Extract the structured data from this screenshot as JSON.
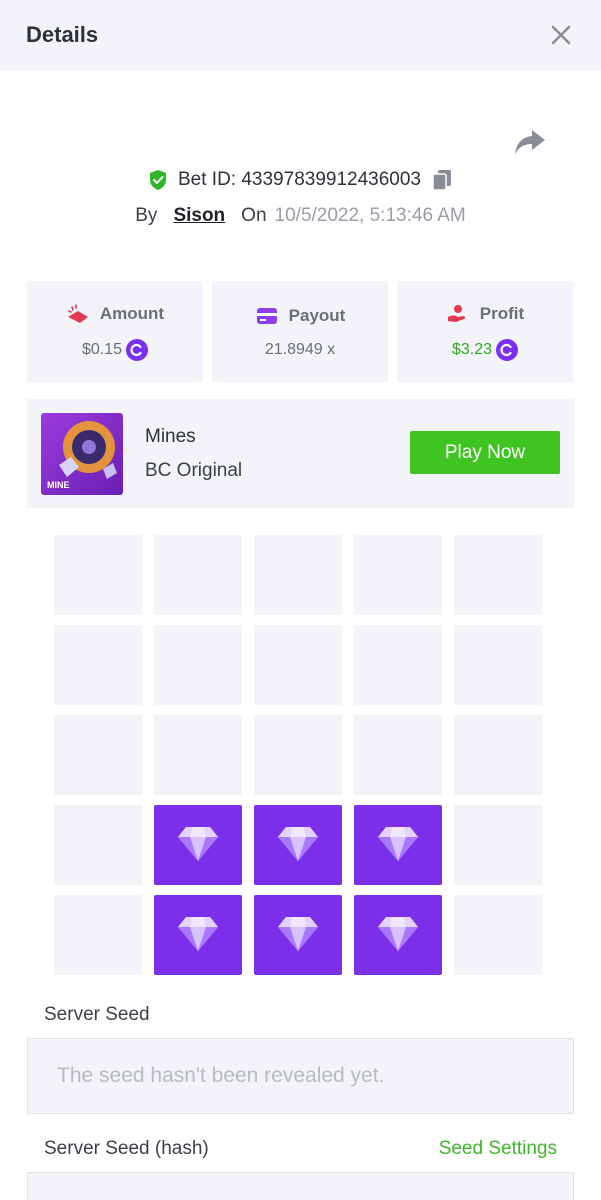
{
  "header": {
    "title": "Details",
    "close_icon": "close-icon"
  },
  "bet": {
    "id_label": "Bet ID: 43397839912436003",
    "by_label": "By",
    "user": "Sison",
    "on_label": "On",
    "date": "10/5/2022, 5:13:46 AM"
  },
  "stats": {
    "amount": {
      "label": "Amount",
      "value": "$0.15"
    },
    "payout": {
      "label": "Payout",
      "value": "21.8949 x"
    },
    "profit": {
      "label": "Profit",
      "value": "$3.23"
    }
  },
  "game": {
    "name": "Mines",
    "provider": "BC Original",
    "thumb_text": "MINE",
    "play_label": "Play Now"
  },
  "grid": {
    "rows": [
      [
        "empty",
        "empty",
        "empty",
        "empty",
        "empty"
      ],
      [
        "empty",
        "empty",
        "empty",
        "empty",
        "empty"
      ],
      [
        "empty",
        "empty",
        "empty",
        "empty",
        "empty"
      ],
      [
        "empty",
        "gem",
        "gem",
        "gem",
        "empty"
      ],
      [
        "empty",
        "gem",
        "gem",
        "gem",
        "empty"
      ]
    ]
  },
  "seeds": {
    "server_seed_label": "Server Seed",
    "server_seed_value": "The seed hasn't been revealed yet.",
    "server_seed_hash_label": "Server Seed (hash)",
    "seed_settings_label": "Seed Settings"
  },
  "colors": {
    "accent_purple": "#7c2fe8",
    "play_green": "#3fc422",
    "profit_green": "#2fa823",
    "panel_bg": "#f3f4f8"
  }
}
